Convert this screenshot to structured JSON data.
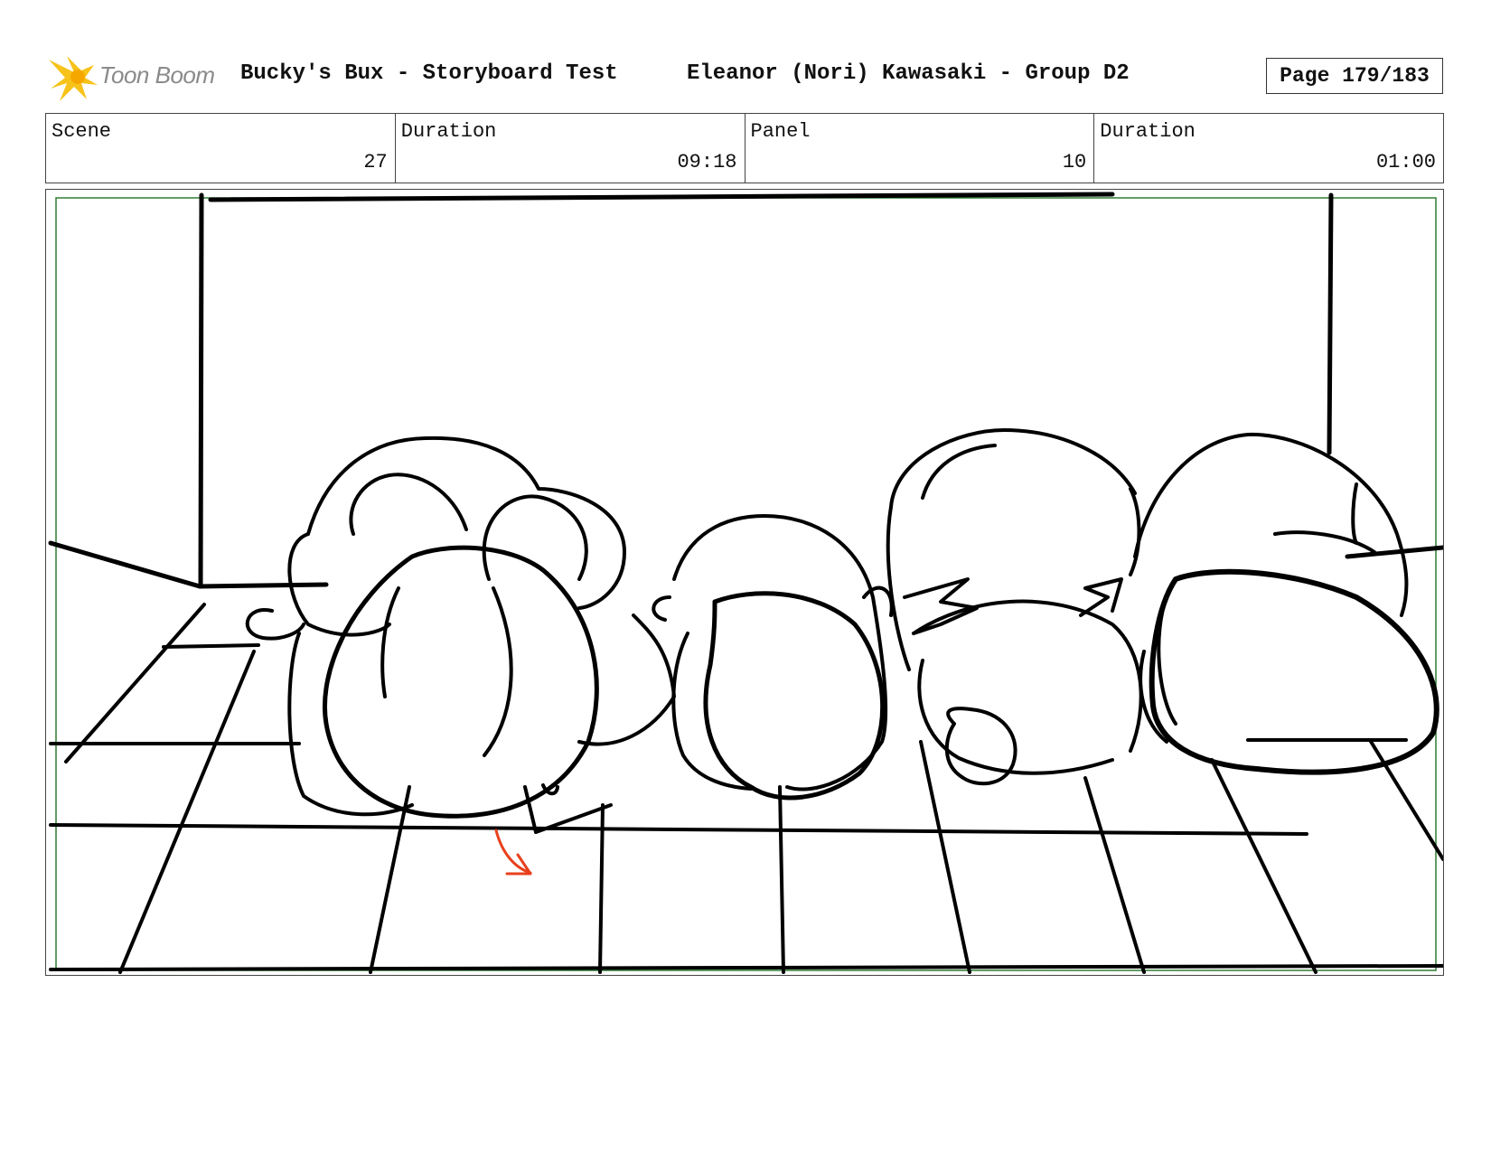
{
  "header": {
    "logo_text": "Toon Boom",
    "title": "Bucky's Bux - Storyboard Test",
    "artist": "Eleanor (Nori) Kawasaki - Group D2",
    "page": "Page 179/183"
  },
  "info": {
    "scene_label": "Scene",
    "scene_value": "27",
    "scene_duration_label": "Duration",
    "scene_duration_value": "09:18",
    "panel_label": "Panel",
    "panel_value": "10",
    "panel_duration_label": "Duration",
    "panel_duration_value": "01:00"
  },
  "colors": {
    "logo_star": "#f7c31a",
    "safe_frame": "#2e7d32",
    "direction_arrow": "#e8401c",
    "sketch_line": "#000000"
  }
}
